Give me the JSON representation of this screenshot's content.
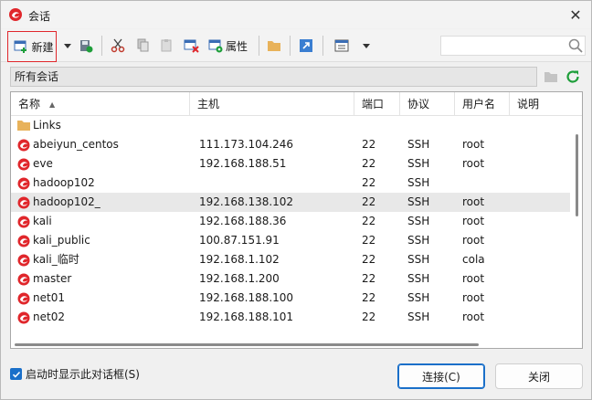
{
  "window": {
    "title": "会话",
    "close_symbol": "✕"
  },
  "toolbar": {
    "new_label": "新建",
    "properties_label": "属性",
    "search_placeholder": ""
  },
  "path": {
    "current": "所有会话"
  },
  "columns": [
    "名称",
    "主机",
    "端口",
    "协议",
    "用户名",
    "说明"
  ],
  "sessions": [
    {
      "icon": "folder-icon",
      "name": "Links",
      "host": "",
      "port": "",
      "protocol": "",
      "user": ""
    },
    {
      "icon": "session-icon",
      "name": "abeiyun_centos",
      "host": "111.173.104.246",
      "port": "22",
      "protocol": "SSH",
      "user": "root"
    },
    {
      "icon": "session-icon",
      "name": "eve",
      "host": "192.168.188.51",
      "port": "22",
      "protocol": "SSH",
      "user": "root"
    },
    {
      "icon": "session-icon",
      "name": "hadoop102",
      "host": "",
      "port": "22",
      "protocol": "SSH",
      "user": ""
    },
    {
      "icon": "session-icon",
      "name": "hadoop102_",
      "host": "192.168.138.102",
      "port": "22",
      "protocol": "SSH",
      "user": "root"
    },
    {
      "icon": "session-icon",
      "name": "kali",
      "host": "192.168.188.36",
      "port": "22",
      "protocol": "SSH",
      "user": "root"
    },
    {
      "icon": "session-icon",
      "name": "kali_public",
      "host": "100.87.151.91",
      "port": "22",
      "protocol": "SSH",
      "user": "root"
    },
    {
      "icon": "session-icon",
      "name": "kali_临时",
      "host": "192.168.1.102",
      "port": "22",
      "protocol": "SSH",
      "user": "cola"
    },
    {
      "icon": "session-icon",
      "name": "master",
      "host": "192.168.1.200",
      "port": "22",
      "protocol": "SSH",
      "user": "root"
    },
    {
      "icon": "session-icon",
      "name": "net01",
      "host": "192.168.188.100",
      "port": "22",
      "protocol": "SSH",
      "user": "root"
    },
    {
      "icon": "session-icon",
      "name": "net02",
      "host": "192.168.188.101",
      "port": "22",
      "protocol": "SSH",
      "user": "root"
    }
  ],
  "selected_index": 4,
  "footer": {
    "startup_label": "启动时显示此对话框(S)",
    "startup_checked": true,
    "connect_label": "连接(C)",
    "close_label": "关闭"
  },
  "colors": {
    "accent": "#1a6fc9",
    "session_icon": "#e0262b",
    "folder": "#e8b25a",
    "refresh": "#1e9e3a"
  }
}
